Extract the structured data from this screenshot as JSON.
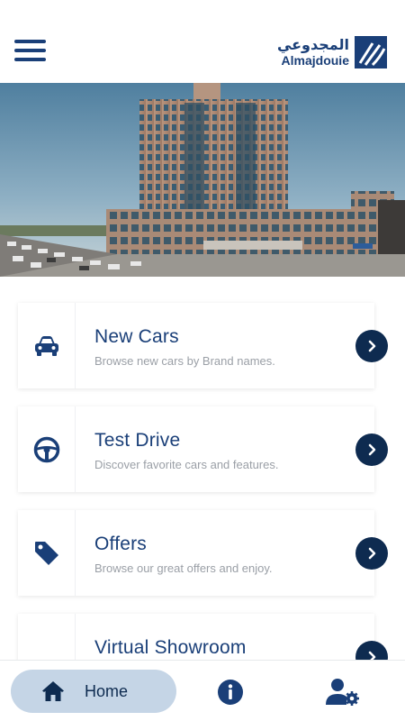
{
  "header": {
    "logo_arabic": "المجدوعي",
    "logo_english": "Almajdouie"
  },
  "colors": {
    "brand_navy": "#1a3f78",
    "arrow_button": "#0e2b50",
    "nav_home_pill": "#c5d5e6",
    "subtitle_gray": "#9a9fa6"
  },
  "menu": [
    {
      "title": "New Cars",
      "subtitle": "Browse new cars by Brand names.",
      "icon": "car-icon"
    },
    {
      "title": "Test Drive",
      "subtitle": "Discover favorite cars and features.",
      "icon": "steering-wheel-icon"
    },
    {
      "title": "Offers",
      "subtitle": "Browse our great offers and enjoy.",
      "icon": "tag-icon"
    },
    {
      "title": "Virtual Showroom",
      "subtitle": "",
      "icon": "vr-headset-icon"
    }
  ],
  "nav": {
    "home_label": "Home",
    "info_icon": "info-icon",
    "profile_icon": "user-settings-icon"
  }
}
